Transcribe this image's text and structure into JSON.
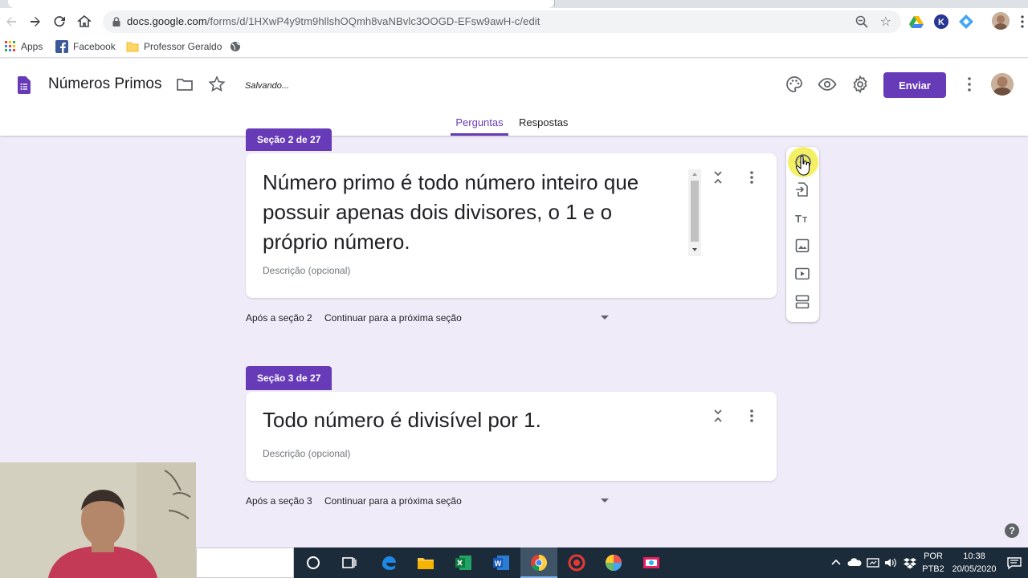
{
  "browser": {
    "url_host": "docs.google.com",
    "url_path": "/forms/d/1HXwP4y9tm9hllshOQmh8vaNBvlc3OOGD-EFsw9awH-c/edit",
    "bookmarks": [
      {
        "label": "Apps",
        "icon": "apps-grid-icon"
      },
      {
        "label": "Facebook",
        "icon": "facebook-icon"
      },
      {
        "label": "Professor Geraldo",
        "icon": "folder-icon"
      },
      {
        "label": "",
        "icon": "globe-icon"
      }
    ]
  },
  "header": {
    "title": "Números Primos",
    "status": "Salvando...",
    "send_label": "Enviar",
    "accent": "#673ab7"
  },
  "tabs": [
    {
      "label": "Perguntas",
      "active": true
    },
    {
      "label": "Respostas",
      "active": false
    }
  ],
  "sections": [
    {
      "tag": "Seção 2 de 27",
      "title": "Número primo é todo número inteiro que possuir apenas dois divisores, o 1 e o próprio número.",
      "description_placeholder": "Descrição (opcional)",
      "after_label": "Após a seção 2",
      "after_value": "Continuar para a próxima seção"
    },
    {
      "tag": "Seção 3 de 27",
      "title": "Todo número é divisível por 1.",
      "description_placeholder": "Descrição (opcional)",
      "after_label": "Após a seção 3",
      "after_value": "Continuar para a próxima seção"
    }
  ],
  "rail": [
    "add-question-icon",
    "import-questions-icon",
    "add-title-icon",
    "add-image-icon",
    "add-video-icon",
    "add-section-icon"
  ],
  "help_label": "?",
  "taskbar": {
    "lang_top": "POR",
    "lang_bottom": "PTB2",
    "time": "10:38",
    "date": "20/05/2020"
  }
}
